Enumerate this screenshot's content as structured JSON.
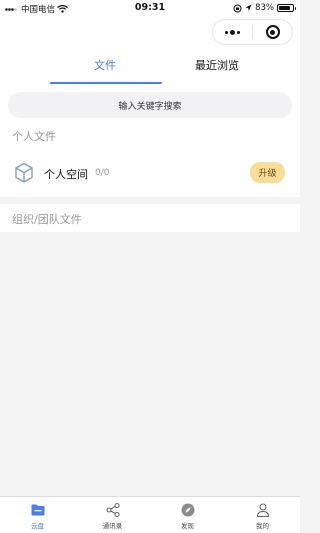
{
  "status_bar": {
    "carrier": "中国电信",
    "time": "09:31",
    "battery": "83%",
    "battery_level": 0.83
  },
  "tabs": [
    {
      "label": "文件",
      "active": true
    },
    {
      "label": "最近浏览",
      "active": false
    }
  ],
  "search": {
    "placeholder": "输入关键字搜索"
  },
  "personal": {
    "section_title": "个人文件",
    "space_name": "个人空间",
    "usage": "0/0",
    "upgrade_label": "升级"
  },
  "org": {
    "section_title": "组织/团队文件"
  },
  "tabbar": [
    {
      "label": "云盘",
      "icon": "folder-icon",
      "active": true
    },
    {
      "label": "通讯录",
      "icon": "share-nodes-icon",
      "active": false
    },
    {
      "label": "发现",
      "icon": "compass-icon",
      "active": false
    },
    {
      "label": "我的",
      "icon": "user-icon",
      "active": false
    }
  ],
  "colors": {
    "accent": "#4a7bf7",
    "upgrade_bg": "#f7dd96",
    "page_bg": "#f3f3f4"
  }
}
